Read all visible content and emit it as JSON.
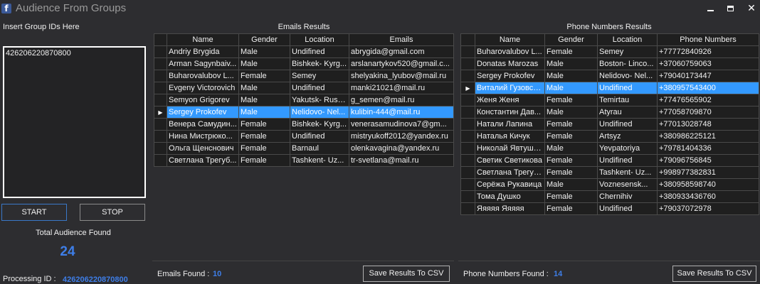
{
  "window": {
    "title": "Audience From Groups",
    "app_icon": "facebook-icon",
    "minimize_icon": "minimize-icon",
    "maximize_icon": "maximize-icon",
    "close_glyph": "✕"
  },
  "left": {
    "insert_label": "Insert Group IDs Here",
    "group_ids_value": "426206220870800",
    "start_label": "START",
    "stop_label": "STOP",
    "total_label": "Total Audience Found",
    "total_count": "24",
    "processing_label": "Processing ID :",
    "processing_id": "426206220870800"
  },
  "emails": {
    "title": "Emails Results",
    "columns": [
      "Name",
      "Gender",
      "Location",
      "Emails"
    ],
    "selected_index": 5,
    "rows": [
      [
        "Andriy Brygida",
        "Male",
        "Undifined",
        "abrygida@gmail.com"
      ],
      [
        "Arman Sagynbaiv...",
        "Male",
        "Bishkek- Kyrg...",
        "arslanartykov520@gmail.c..."
      ],
      [
        "Buharovalubov L...",
        "Female",
        "Semey",
        "shelyakina_lyubov@mail.ru"
      ],
      [
        "Evgeny Victorovich",
        "Male",
        "Undifined",
        "manki21021@mail.ru"
      ],
      [
        "Semyon Grigorev",
        "Male",
        "Yakutsk- Russia",
        "g_semen@mail.ru"
      ],
      [
        "Sergey  Prokofev",
        "Male",
        "Nelidovo- Nel...",
        "kulibin-444@mail.ru"
      ],
      [
        "Венера Самудин...",
        "Female",
        "Bishkek- Kyrg...",
        "venerasamudinova7@gm..."
      ],
      [
        "Нина Мистрюко...",
        "Female",
        "Undifined",
        "mistryukoff2012@yandex.ru"
      ],
      [
        "Ольга Щенснович",
        "Female",
        "Barnaul",
        "olenkavagina@yandex.ru"
      ],
      [
        "Светлана Трегуб...",
        "Female",
        "Tashkent- Uz...",
        "tr-svetlana@mail.ru"
      ]
    ],
    "found_label": "Emails Found :",
    "found_count": "10",
    "save_label": "Save Results To CSV"
  },
  "phones": {
    "title": "Phone Numbers Results",
    "columns": [
      "Name",
      "Gender",
      "Location",
      "Phone Numbers"
    ],
    "selected_index": 3,
    "rows": [
      [
        "Buharovalubov L...",
        "Female",
        "Semey",
        "+77772840926"
      ],
      [
        "Donatas Marozas",
        "Male",
        "Boston- Linco...",
        "+37060759063"
      ],
      [
        "Sergey  Prokofev",
        "Male",
        "Nelidovo- Nel...",
        "+79040173447"
      ],
      [
        "Виталий  Гузовск...",
        "Male",
        "Undifined",
        "+380957543400"
      ],
      [
        "Женя Женя",
        "Female",
        "Temirtau",
        "+77476565902"
      ],
      [
        "Константин Дав...",
        "Male",
        "Atyrau",
        "+77058709870"
      ],
      [
        "Натали Лапина",
        "Female",
        "Undifined",
        "+77013028748"
      ],
      [
        "Наталья Кичук",
        "Female",
        "Artsyz",
        "+380986225121"
      ],
      [
        "Николай Явтуше...",
        "Male",
        "Yevpatoriya",
        "+79781404336"
      ],
      [
        "Светик Светикова",
        "Female",
        "Undifined",
        "+79096756845"
      ],
      [
        "Светлана Трегуб...",
        "Female",
        "Tashkent- Uz...",
        "+998977382831"
      ],
      [
        "Серёжа Рукавица",
        "Male",
        "Voznesensk...",
        "+380958598740"
      ],
      [
        "Тома Душко",
        "Female",
        "Chernihiv",
        "+380933436760"
      ],
      [
        "Яяяяя Яяяяя",
        "Female",
        "Undifined",
        "+79037072978"
      ]
    ],
    "found_label": "Phone Numbers Found :",
    "found_count": "14",
    "save_label": "Save Results To CSV"
  },
  "row_arrow_glyph": "▶",
  "colors": {
    "accent": "#3e7ee8",
    "selection": "#3399ff",
    "background": "#2d2d30"
  }
}
